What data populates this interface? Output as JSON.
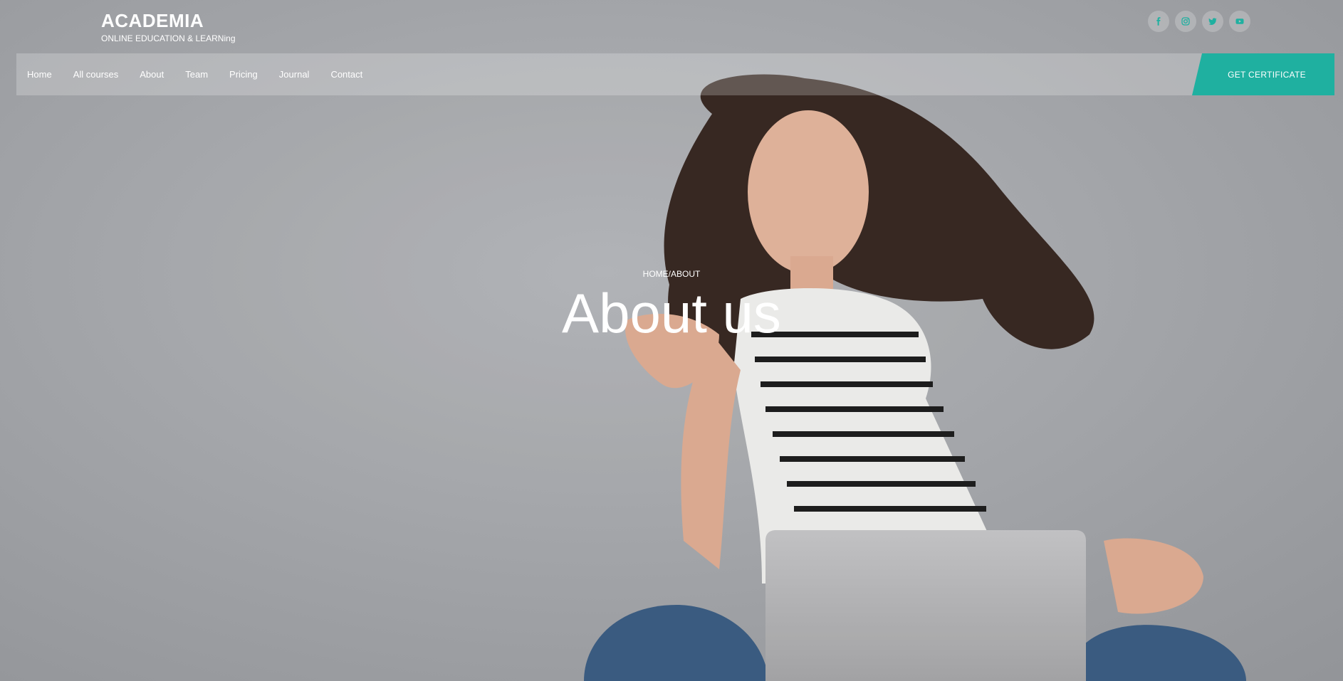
{
  "brand": {
    "title": "ACADEMIA",
    "subtitle": "ONLINE EDUCATION & LEARNing"
  },
  "social": [
    {
      "icon": "facebook-icon"
    },
    {
      "icon": "instagram-icon"
    },
    {
      "icon": "twitter-icon"
    },
    {
      "icon": "youtube-icon"
    }
  ],
  "nav": {
    "items": [
      "Home",
      "All courses",
      "About",
      "Team",
      "Pricing",
      "Journal",
      "Contact"
    ],
    "cta_label": "GET CERTIFICATE"
  },
  "hero": {
    "breadcrumb_home": "HOME",
    "breadcrumb_sep": "/",
    "breadcrumb_current": "ABOUT",
    "title": "About us"
  },
  "colors": {
    "accent": "#1fb0a0",
    "background": "#a9abaf",
    "text": "#ffffff"
  }
}
